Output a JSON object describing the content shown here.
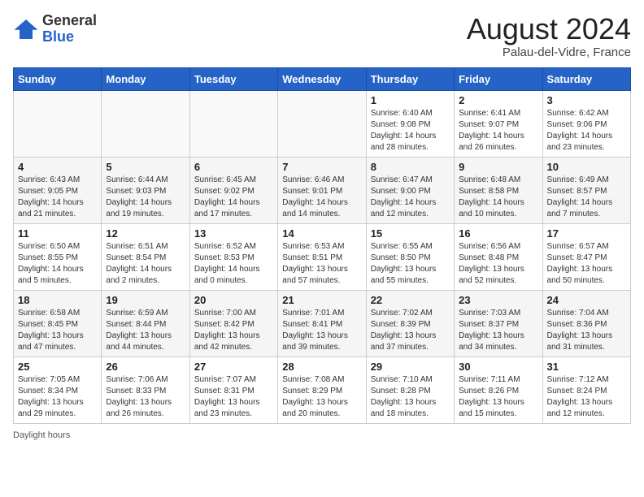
{
  "header": {
    "logo_general": "General",
    "logo_blue": "Blue",
    "month_year": "August 2024",
    "location": "Palau-del-Vidre, France"
  },
  "weekdays": [
    "Sunday",
    "Monday",
    "Tuesday",
    "Wednesday",
    "Thursday",
    "Friday",
    "Saturday"
  ],
  "weeks": [
    [
      {
        "day": "",
        "info": ""
      },
      {
        "day": "",
        "info": ""
      },
      {
        "day": "",
        "info": ""
      },
      {
        "day": "",
        "info": ""
      },
      {
        "day": "1",
        "info": "Sunrise: 6:40 AM\nSunset: 9:08 PM\nDaylight: 14 hours\nand 28 minutes."
      },
      {
        "day": "2",
        "info": "Sunrise: 6:41 AM\nSunset: 9:07 PM\nDaylight: 14 hours\nand 26 minutes."
      },
      {
        "day": "3",
        "info": "Sunrise: 6:42 AM\nSunset: 9:06 PM\nDaylight: 14 hours\nand 23 minutes."
      }
    ],
    [
      {
        "day": "4",
        "info": "Sunrise: 6:43 AM\nSunset: 9:05 PM\nDaylight: 14 hours\nand 21 minutes."
      },
      {
        "day": "5",
        "info": "Sunrise: 6:44 AM\nSunset: 9:03 PM\nDaylight: 14 hours\nand 19 minutes."
      },
      {
        "day": "6",
        "info": "Sunrise: 6:45 AM\nSunset: 9:02 PM\nDaylight: 14 hours\nand 17 minutes."
      },
      {
        "day": "7",
        "info": "Sunrise: 6:46 AM\nSunset: 9:01 PM\nDaylight: 14 hours\nand 14 minutes."
      },
      {
        "day": "8",
        "info": "Sunrise: 6:47 AM\nSunset: 9:00 PM\nDaylight: 14 hours\nand 12 minutes."
      },
      {
        "day": "9",
        "info": "Sunrise: 6:48 AM\nSunset: 8:58 PM\nDaylight: 14 hours\nand 10 minutes."
      },
      {
        "day": "10",
        "info": "Sunrise: 6:49 AM\nSunset: 8:57 PM\nDaylight: 14 hours\nand 7 minutes."
      }
    ],
    [
      {
        "day": "11",
        "info": "Sunrise: 6:50 AM\nSunset: 8:55 PM\nDaylight: 14 hours\nand 5 minutes."
      },
      {
        "day": "12",
        "info": "Sunrise: 6:51 AM\nSunset: 8:54 PM\nDaylight: 14 hours\nand 2 minutes."
      },
      {
        "day": "13",
        "info": "Sunrise: 6:52 AM\nSunset: 8:53 PM\nDaylight: 14 hours\nand 0 minutes."
      },
      {
        "day": "14",
        "info": "Sunrise: 6:53 AM\nSunset: 8:51 PM\nDaylight: 13 hours\nand 57 minutes."
      },
      {
        "day": "15",
        "info": "Sunrise: 6:55 AM\nSunset: 8:50 PM\nDaylight: 13 hours\nand 55 minutes."
      },
      {
        "day": "16",
        "info": "Sunrise: 6:56 AM\nSunset: 8:48 PM\nDaylight: 13 hours\nand 52 minutes."
      },
      {
        "day": "17",
        "info": "Sunrise: 6:57 AM\nSunset: 8:47 PM\nDaylight: 13 hours\nand 50 minutes."
      }
    ],
    [
      {
        "day": "18",
        "info": "Sunrise: 6:58 AM\nSunset: 8:45 PM\nDaylight: 13 hours\nand 47 minutes."
      },
      {
        "day": "19",
        "info": "Sunrise: 6:59 AM\nSunset: 8:44 PM\nDaylight: 13 hours\nand 44 minutes."
      },
      {
        "day": "20",
        "info": "Sunrise: 7:00 AM\nSunset: 8:42 PM\nDaylight: 13 hours\nand 42 minutes."
      },
      {
        "day": "21",
        "info": "Sunrise: 7:01 AM\nSunset: 8:41 PM\nDaylight: 13 hours\nand 39 minutes."
      },
      {
        "day": "22",
        "info": "Sunrise: 7:02 AM\nSunset: 8:39 PM\nDaylight: 13 hours\nand 37 minutes."
      },
      {
        "day": "23",
        "info": "Sunrise: 7:03 AM\nSunset: 8:37 PM\nDaylight: 13 hours\nand 34 minutes."
      },
      {
        "day": "24",
        "info": "Sunrise: 7:04 AM\nSunset: 8:36 PM\nDaylight: 13 hours\nand 31 minutes."
      }
    ],
    [
      {
        "day": "25",
        "info": "Sunrise: 7:05 AM\nSunset: 8:34 PM\nDaylight: 13 hours\nand 29 minutes."
      },
      {
        "day": "26",
        "info": "Sunrise: 7:06 AM\nSunset: 8:33 PM\nDaylight: 13 hours\nand 26 minutes."
      },
      {
        "day": "27",
        "info": "Sunrise: 7:07 AM\nSunset: 8:31 PM\nDaylight: 13 hours\nand 23 minutes."
      },
      {
        "day": "28",
        "info": "Sunrise: 7:08 AM\nSunset: 8:29 PM\nDaylight: 13 hours\nand 20 minutes."
      },
      {
        "day": "29",
        "info": "Sunrise: 7:10 AM\nSunset: 8:28 PM\nDaylight: 13 hours\nand 18 minutes."
      },
      {
        "day": "30",
        "info": "Sunrise: 7:11 AM\nSunset: 8:26 PM\nDaylight: 13 hours\nand 15 minutes."
      },
      {
        "day": "31",
        "info": "Sunrise: 7:12 AM\nSunset: 8:24 PM\nDaylight: 13 hours\nand 12 minutes."
      }
    ]
  ],
  "footer": {
    "daylight_label": "Daylight hours"
  }
}
